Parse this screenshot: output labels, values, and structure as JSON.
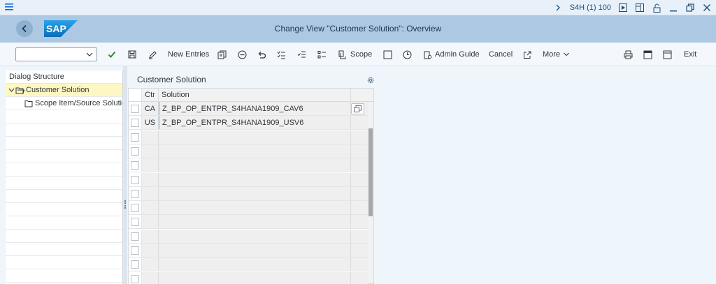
{
  "titlebar": {
    "system": "S4H (1) 100",
    "icons": [
      "menu-icon",
      "chevron-right-icon",
      "play-icon",
      "layout-icon",
      "lock-icon",
      "minimize-icon",
      "restore-icon",
      "close-icon"
    ]
  },
  "header": {
    "title": "Change View \"Customer Solution\": Overview",
    "logo": "SAP",
    "colors": {
      "header_bg": "#adc8e3",
      "accent": "#0a6ed1",
      "logo_blue": "#1a8ad4"
    }
  },
  "toolbar": {
    "command_field": {
      "value": "",
      "placeholder": ""
    },
    "new_entries": "New Entries",
    "scope": "Scope",
    "admin_guide": "Admin Guide",
    "cancel": "Cancel",
    "more": "More",
    "exit": "Exit"
  },
  "dialog_structure": {
    "heading": "Dialog Structure",
    "items": [
      {
        "label": "Customer Solution",
        "selected": true,
        "level": 0
      },
      {
        "label": "Scope Item/Source Solutio",
        "selected": false,
        "level": 1
      }
    ]
  },
  "table": {
    "title": "Customer Solution",
    "columns": [
      "Ctr",
      "Solution"
    ],
    "rows": [
      {
        "ctr": "CA",
        "solution": "Z_BP_OP_ENTPR_S4HANA1909_CAV6"
      },
      {
        "ctr": "US",
        "solution": "Z_BP_OP_ENTPR_S4HANA1909_USV6"
      }
    ],
    "empty_rows": 11
  }
}
